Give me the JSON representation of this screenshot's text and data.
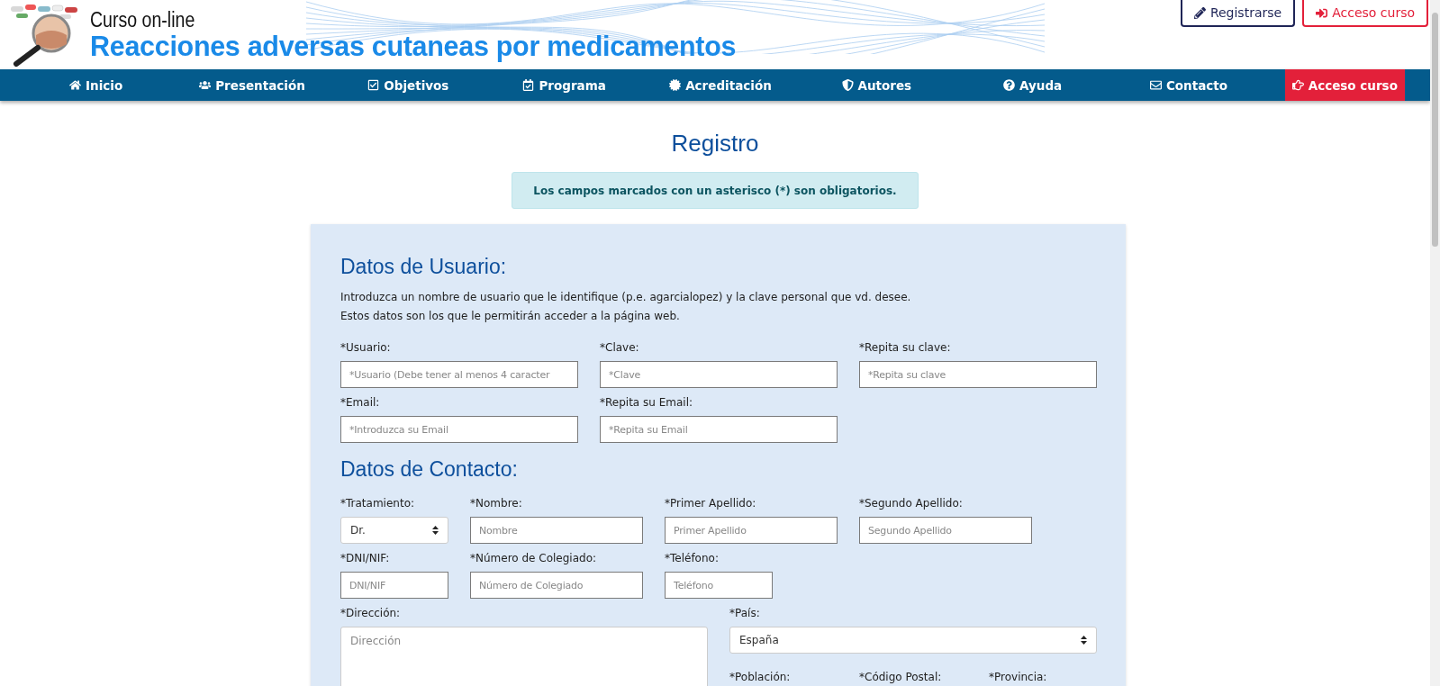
{
  "header": {
    "subtitle": "Curso on-line",
    "title": "Reacciones adversas cutaneas por medicamentos",
    "buttons": [
      {
        "label": "Registrarse",
        "kind": "dark"
      },
      {
        "label": "Acceso curso",
        "kind": "red"
      }
    ]
  },
  "nav": [
    {
      "label": "Inicio",
      "kind": "link"
    },
    {
      "label": "Presentación",
      "kind": "link"
    },
    {
      "label": "Objetivos",
      "kind": "link"
    },
    {
      "label": "Programa",
      "kind": "link"
    },
    {
      "label": "Acreditación",
      "kind": "link"
    },
    {
      "label": "Autores",
      "kind": "link"
    },
    {
      "label": "Ayuda",
      "kind": "link"
    },
    {
      "label": "Contacto",
      "kind": "link"
    },
    {
      "label": "Acceso curso",
      "kind": "highlight"
    }
  ],
  "page_title": "Registro",
  "notice": "Los campos marcados con un asterisco (*) son obligatorios.",
  "sections": [
    {
      "heading": "Datos de Usuario:",
      "intro": [
        "Introduzca un nombre de usuario que le identifique (p.e. agarcialopez) y la clave personal que vd. desee.",
        "Estos datos son los que le permitirán acceder a la página web."
      ],
      "fields": [
        {
          "label": "*Usuario:",
          "kind": "input",
          "placeholder": "*Usuario (Debe tener al menos 4 caracter"
        },
        {
          "label": "*Clave:",
          "kind": "input",
          "placeholder": "*Clave"
        },
        {
          "label": "*Repita su clave:",
          "kind": "input",
          "placeholder": "*Repita su clave"
        },
        {
          "label": "*Email:",
          "kind": "input",
          "placeholder": "*Introduzca su Email"
        },
        {
          "label": "*Repita su Email:",
          "kind": "input",
          "placeholder": "*Repita su Email"
        }
      ]
    },
    {
      "heading": "Datos de Contacto:",
      "fields": [
        {
          "label": "*Tratamiento:",
          "kind": "select",
          "value": "Dr."
        },
        {
          "label": "*Nombre:",
          "kind": "input",
          "placeholder": "Nombre"
        },
        {
          "label": "*Primer Apellido:",
          "kind": "input",
          "placeholder": "Primer Apellido"
        },
        {
          "label": "*Segundo Apellido:",
          "kind": "input",
          "placeholder": "Segundo Apellido"
        },
        {
          "label": "*DNI/NIF:",
          "kind": "input",
          "placeholder": "DNI/NIF"
        },
        {
          "label": "*Número de Colegiado:",
          "kind": "input",
          "placeholder": "Número de Colegiado"
        },
        {
          "label": "*Teléfono:",
          "kind": "input",
          "placeholder": "Teléfono"
        },
        {
          "label": "*Dirección:",
          "kind": "textarea",
          "placeholder": "Dirección"
        },
        {
          "label": "*País:",
          "kind": "select",
          "value": "España"
        },
        {
          "label": "*Población:",
          "kind": "label"
        },
        {
          "label": "*Código Postal:",
          "kind": "label"
        },
        {
          "label": "*Provincia:",
          "kind": "label"
        }
      ]
    }
  ]
}
